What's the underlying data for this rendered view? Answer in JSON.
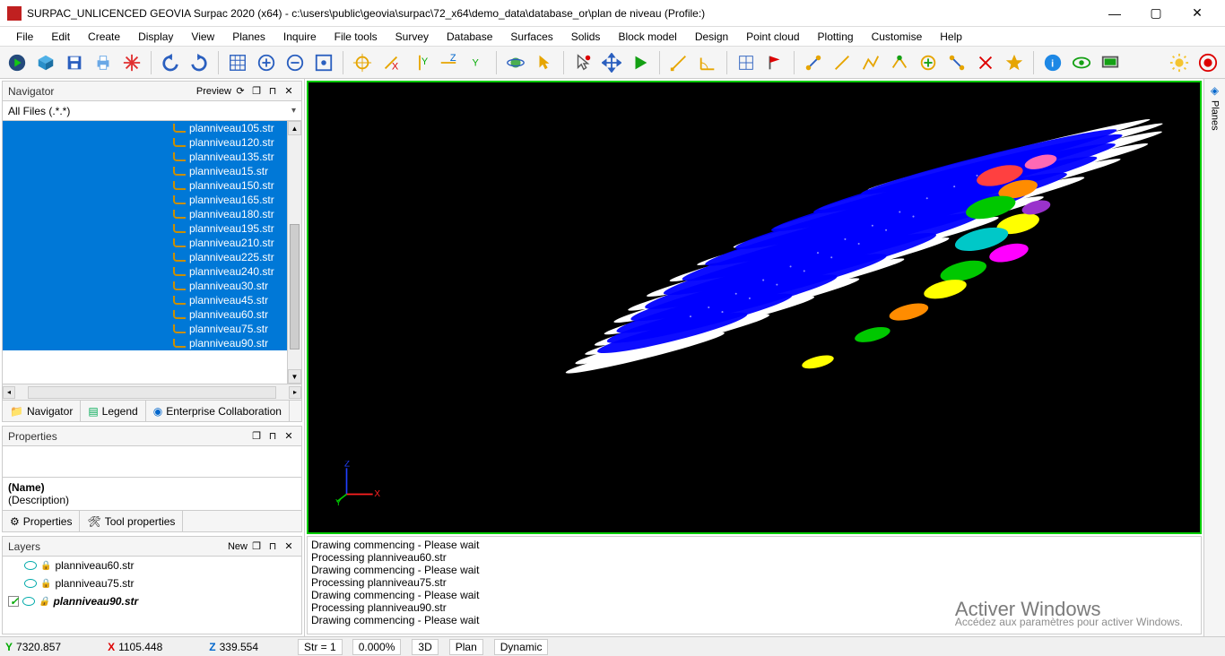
{
  "window": {
    "title": "SURPAC_UNLICENCED GEOVIA Surpac 2020 (x64) - c:\\users\\public\\geovia\\surpac\\72_x64\\demo_data\\database_or\\plan de niveau (Profile:)"
  },
  "menu": [
    "File",
    "Edit",
    "Create",
    "Display",
    "View",
    "Planes",
    "Inquire",
    "File tools",
    "Survey",
    "Database",
    "Surfaces",
    "Solids",
    "Block model",
    "Design",
    "Point cloud",
    "Plotting",
    "Customise",
    "Help"
  ],
  "navigator": {
    "title": "Navigator",
    "preview": "Preview",
    "filter": "All Files (.*.*)",
    "files": [
      "planniveau105.str",
      "planniveau120.str",
      "planniveau135.str",
      "planniveau15.str",
      "planniveau150.str",
      "planniveau165.str",
      "planniveau180.str",
      "planniveau195.str",
      "planniveau210.str",
      "planniveau225.str",
      "planniveau240.str",
      "planniveau30.str",
      "planniveau45.str",
      "planniveau60.str",
      "planniveau75.str",
      "planniveau90.str"
    ],
    "tabs": {
      "navigator": "Navigator",
      "legend": "Legend",
      "collab": "Enterprise Collaboration"
    }
  },
  "properties": {
    "title": "Properties",
    "name_label": "(Name)",
    "desc_label": "(Description)",
    "tabs": {
      "props": "Properties",
      "tool": "Tool properties"
    }
  },
  "layers": {
    "title": "Layers",
    "new": "New",
    "items": [
      {
        "name": "planniveau60.str",
        "active": false
      },
      {
        "name": "planniveau75.str",
        "active": false
      },
      {
        "name": "planniveau90.str",
        "active": true
      }
    ]
  },
  "console_lines": [
    "Drawing commencing - Please wait",
    "Processing planniveau60.str",
    "Drawing commencing - Please wait",
    "Processing planniveau75.str",
    "Drawing commencing - Please wait",
    "Processing planniveau90.str",
    "Drawing commencing - Please wait"
  ],
  "watermark": {
    "line1": "Activer Windows",
    "line2": "Accédez aux paramètres pour activer Windows."
  },
  "status": {
    "y": "7320.857",
    "x": "1105.448",
    "z": "339.554",
    "str_label": "Str = 1",
    "pct": "0.000%",
    "mode1": "3D",
    "mode2": "Plan",
    "mode3": "Dynamic"
  },
  "right_panel": {
    "label": "Planes"
  },
  "axis": {
    "x": "X",
    "y": "Y",
    "z": "Z"
  }
}
